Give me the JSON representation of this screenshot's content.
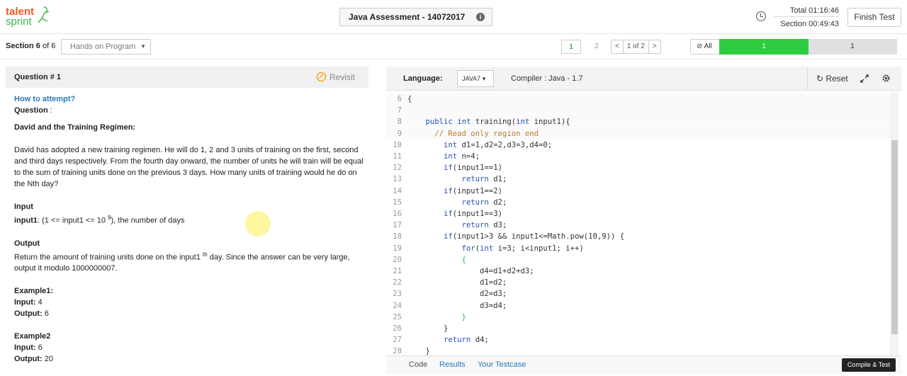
{
  "logo": {
    "line1": "talent",
    "line2": "sprint"
  },
  "header": {
    "assessment_title": "Java Assessment - 14072017",
    "info_icon": "info-icon",
    "total_timer": "Total 01:16:46",
    "section_timer": "Section 00:49:43",
    "finish_label": "Finish Test"
  },
  "section_bar": {
    "section_label": "Section 6",
    "section_of": " of 6",
    "section_select": "Hands on Program",
    "pages": [
      "1",
      "2"
    ],
    "prev": "<",
    "page_indicator": "1 of 2",
    "next": ">",
    "all_label": "All",
    "progress_done": "1",
    "progress_remaining": "1",
    "progress_fraction": 0.5
  },
  "question": {
    "title": "Question # 1",
    "revisit_label": "Revisit",
    "how_to": "How to attempt?",
    "question_label": "Question",
    "question_colon": " :",
    "problem_title": "David and the Training Regimen:",
    "description": "David has adopted a new training regimen. He will do 1, 2 and 3 units of training on the first, second and third days respectively. From the fourth day onward, the number of units he will train will be equal to the sum of training units done on the previous 3 days. How many units of training would he do on the Nth day?",
    "input_heading": "Input",
    "input_name": "input1",
    "input_desc_pre": ": (1 <= input1 <= 10 ",
    "input_sup": "9",
    "input_desc_post": "), the number of days",
    "output_heading": "Output",
    "output_pre": "Return the amount of training units done on the input1 ",
    "output_sup": "th",
    "output_post": " day. Since the answer can be very large, output it modulo 1000000007.",
    "examples": [
      {
        "title": "Example1:",
        "input_label": "Input:",
        "input": " 4",
        "output_label": "Output:",
        "output": " 6"
      },
      {
        "title": "Example2",
        "input_label": "Input:",
        "input": " 6",
        "output_label": "Output:",
        "output": " 20"
      }
    ]
  },
  "editor": {
    "language_label": "Language:",
    "language_value": "JAVA7",
    "compiler": "Compiler : Java - 1.7",
    "reset_label": "Reset",
    "lines": [
      {
        "n": "6",
        "t": "{"
      },
      {
        "n": "7",
        "t": ""
      },
      {
        "n": "8",
        "t": "    public int training(int input1){"
      },
      {
        "n": "9",
        "t": "      // Read only region end"
      },
      {
        "n": "10",
        "t": "        int d1=1,d2=2,d3=3,d4=0;"
      },
      {
        "n": "11",
        "t": "        int n=4;"
      },
      {
        "n": "12",
        "t": "        if(input1==1)"
      },
      {
        "n": "13",
        "t": "            return d1;"
      },
      {
        "n": "14",
        "t": "        if(input1==2)"
      },
      {
        "n": "15",
        "t": "            return d2;"
      },
      {
        "n": "16",
        "t": "        if(input1==3)"
      },
      {
        "n": "17",
        "t": "            return d3;"
      },
      {
        "n": "18",
        "t": "        if(input1>3 && input1<=Math.pow(10,9)) {"
      },
      {
        "n": "19",
        "t": "            for(int i=3; i<input1; i++)"
      },
      {
        "n": "20",
        "t": "            {"
      },
      {
        "n": "21",
        "t": "                d4=d1+d2+d3;"
      },
      {
        "n": "22",
        "t": "                d1=d2;"
      },
      {
        "n": "23",
        "t": "                d2=d3;"
      },
      {
        "n": "24",
        "t": "                d3=d4;"
      },
      {
        "n": "25",
        "t": "            }"
      },
      {
        "n": "26",
        "t": "        }"
      },
      {
        "n": "27",
        "t": "        return d4;"
      },
      {
        "n": "28",
        "t": "    }"
      }
    ],
    "tabs": {
      "code": "Code",
      "results": "Results",
      "testcase": "Your Testcase"
    },
    "compile_label": "Compile & Test"
  },
  "colors": {
    "brand_orange": "#ee5a24",
    "brand_green": "#3cb44b",
    "progress_green": "#2ecc40",
    "link_blue": "#2a7ab8",
    "keyword_blue": "#2a4fb3",
    "comment_orange": "#c0792b"
  }
}
